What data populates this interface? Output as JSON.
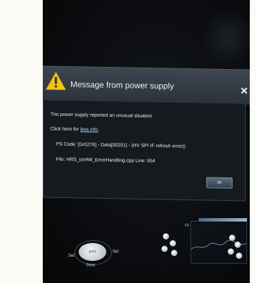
{
  "dialog": {
    "title": "Message from power supply",
    "message": "The power supply reported an unusual situation",
    "click_prefix": "Click here for ",
    "click_link": "less info",
    "click_suffix": ".",
    "ps_code": "PS Code: [0x5276] - Data[00201] - (HV SPI IF refresh error))",
    "file": "File: HRS_io\\HW_ErrorHandling.cpp Line: 654",
    "ok_label": "ok"
  },
  "panel": {
    "set_left": "Set",
    "set_right": "Set",
    "center_button": "pen",
    "print_label": "Print",
    "f0_label": "F0"
  },
  "colors": {
    "warning": "#f3c11b",
    "dialog_header": "#3d4651",
    "dialog_body": "#151a1f"
  },
  "icons": [
    "warning-icon",
    "close-icon"
  ]
}
